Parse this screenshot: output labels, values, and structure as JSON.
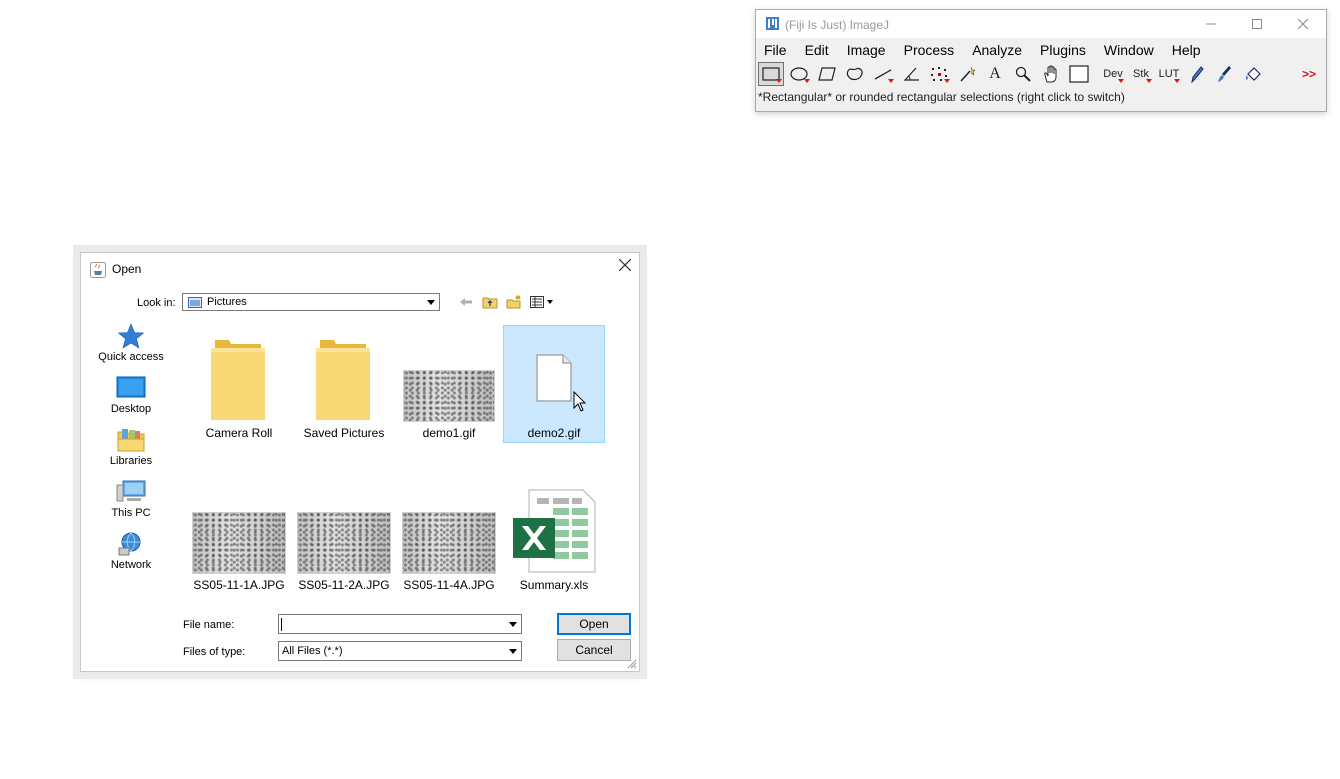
{
  "imagej": {
    "title": "(Fiji Is Just) ImageJ",
    "menus": [
      "File",
      "Edit",
      "Image",
      "Process",
      "Analyze",
      "Plugins",
      "Window",
      "Help"
    ],
    "tools": {
      "dev": "Dev",
      "stk": "Stk",
      "lut": "LUT",
      "text_tool": "A",
      "more": ">>"
    },
    "status": "*Rectangular* or rounded rectangular selections (right click to switch)"
  },
  "dialog": {
    "title": "Open",
    "look_in_label": "Look in:",
    "look_in_value": "Pictures",
    "places": [
      "Quick access",
      "Desktop",
      "Libraries",
      "This PC",
      "Network"
    ],
    "files": [
      {
        "name": "Camera Roll",
        "kind": "folder"
      },
      {
        "name": "Saved Pictures",
        "kind": "folder"
      },
      {
        "name": "demo1.gif",
        "kind": "image"
      },
      {
        "name": "demo2.gif",
        "kind": "blank",
        "selected": true
      },
      {
        "name": "SS05-11-1A.JPG",
        "kind": "photo"
      },
      {
        "name": "SS05-11-2A.JPG",
        "kind": "photo"
      },
      {
        "name": "SS05-11-4A.JPG",
        "kind": "photo"
      },
      {
        "name": "Summary.xls",
        "kind": "excel"
      }
    ],
    "file_name_label": "File name:",
    "file_name_value": "",
    "files_of_type_label": "Files of type:",
    "files_of_type_value": "All Files (*.*)",
    "open_label": "Open",
    "cancel_label": "Cancel"
  },
  "colors": {
    "selection": "#cce8ff",
    "folder": "#f8d775",
    "accent": "#0078d7",
    "excel": "#1e7145"
  }
}
